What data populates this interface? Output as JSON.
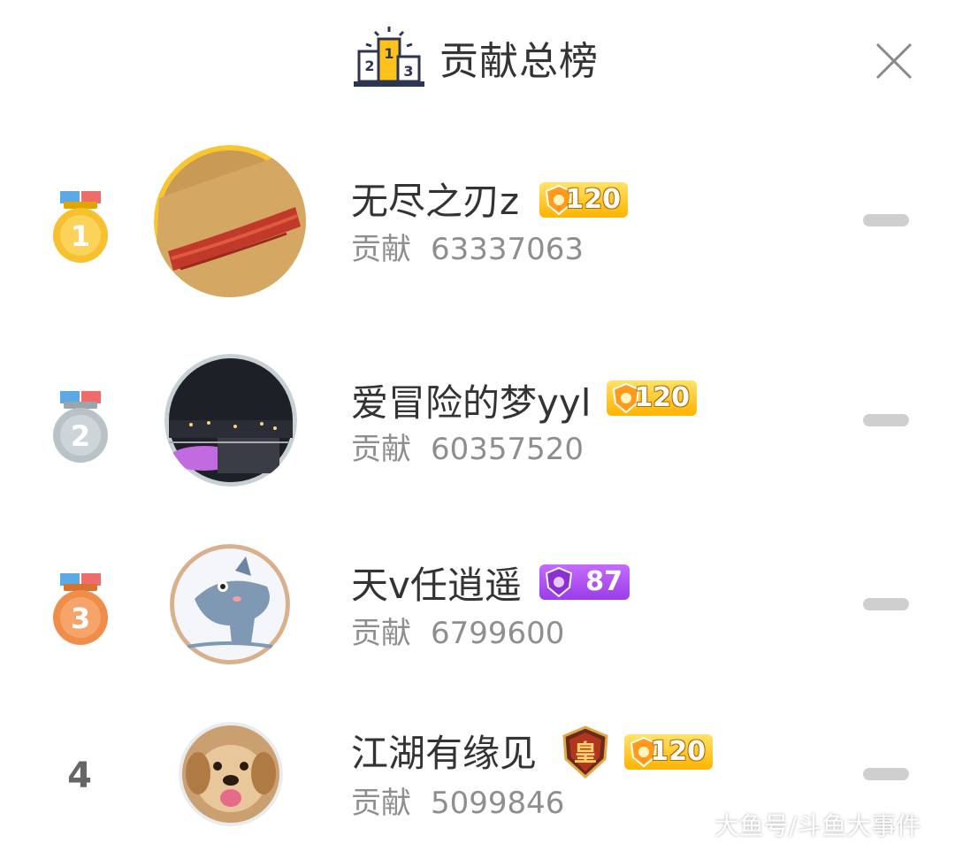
{
  "header": {
    "title": "贡献总榜"
  },
  "rows": [
    {
      "rank": "1",
      "name": "无尽之刃z",
      "label": "贡献",
      "value": "63337063",
      "badge_level": "120",
      "badge_color": "gold",
      "medal_color": "#f6c02e"
    },
    {
      "rank": "2",
      "name": "爱冒险的梦yyl",
      "label": "贡献",
      "value": "60357520",
      "badge_level": "120",
      "badge_color": "gold",
      "medal_color": "#b9c3c7"
    },
    {
      "rank": "3",
      "name": "天v任逍遥",
      "label": "贡献",
      "value": "6799600",
      "badge_level": "87",
      "badge_color": "purple",
      "medal_color": "#f08d4a"
    },
    {
      "rank": "4",
      "name": "江湖有缘见",
      "label": "贡献",
      "value": "5099846",
      "badge_level": "120",
      "badge_color": "gold",
      "extra_badge_text": "皇"
    }
  ],
  "watermark": "大鱼号/斗鱼大事件"
}
